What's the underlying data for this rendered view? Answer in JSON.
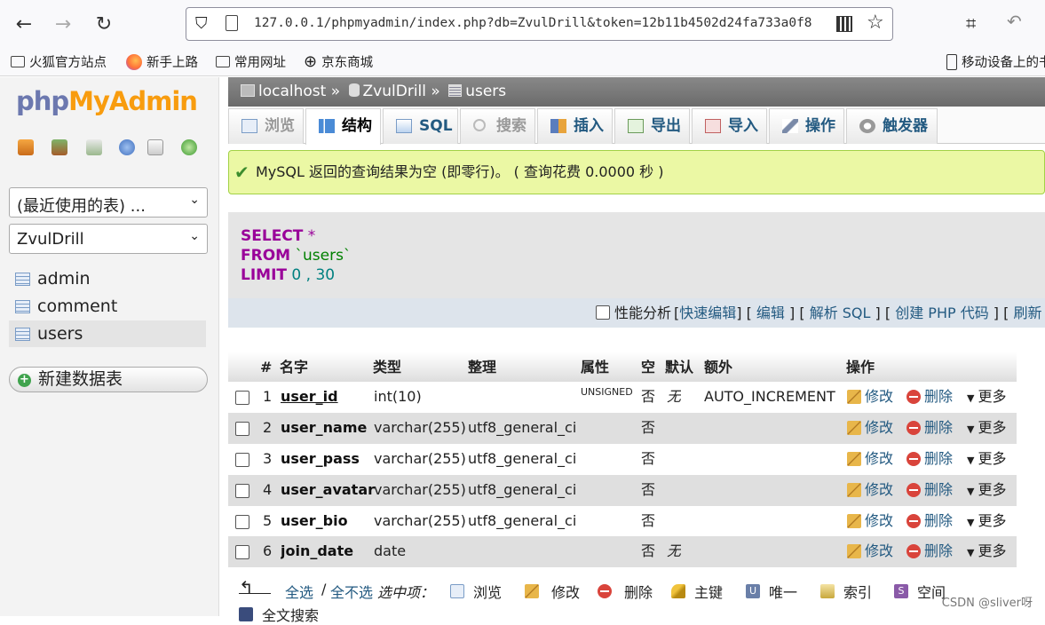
{
  "browser": {
    "url": "127.0.0.1/phpmyadmin/index.php?db=ZvulDrill&token=12b11b4502d24fa733a0f8",
    "bookmarks": [
      "火狐官方站点",
      "新手上路",
      "常用网址",
      "京东商城"
    ],
    "mobile_bookmarks": "移动设备上的书"
  },
  "sidebar": {
    "logo_php": "php",
    "logo_myadmin": "MyAdmin",
    "recent_tables": "(最近使用的表) ...",
    "database": "ZvulDrill",
    "tables": [
      "admin",
      "comment",
      "users"
    ],
    "new_table": "新建数据表"
  },
  "breadcrumb": {
    "server": "localhost",
    "database": "ZvulDrill",
    "table": "users",
    "sep": "»"
  },
  "tabs": [
    "浏览",
    "结构",
    "SQL",
    "搜索",
    "插入",
    "导出",
    "导入",
    "操作",
    "触发器"
  ],
  "notice": "MySQL 返回的查询结果为空 (即零行)。 ( 查询花费 0.0000 秒 )",
  "sql": {
    "select": "SELECT",
    "star": "*",
    "from": "FROM",
    "table": "`users`",
    "limit": "LIMIT",
    "offset": "0",
    "comma": ",",
    "count": "30",
    "profiling": "性能分析",
    "links": [
      "快速编辑",
      "编辑",
      "解析 SQL",
      "创建 PHP 代码",
      "刷新"
    ]
  },
  "structure": {
    "headers": [
      "#",
      "名字",
      "类型",
      "整理",
      "属性",
      "空",
      "默认",
      "额外",
      "操作"
    ],
    "rows": [
      {
        "num": "1",
        "name": "user_id",
        "type": "int(10)",
        "collation": "",
        "attr": "UNSIGNED",
        "null": "否",
        "default": "无",
        "extra": "AUTO_INCREMENT"
      },
      {
        "num": "2",
        "name": "user_name",
        "type": "varchar(255)",
        "collation": "utf8_general_ci",
        "attr": "",
        "null": "否",
        "default": "",
        "extra": ""
      },
      {
        "num": "3",
        "name": "user_pass",
        "type": "varchar(255)",
        "collation": "utf8_general_ci",
        "attr": "",
        "null": "否",
        "default": "",
        "extra": ""
      },
      {
        "num": "4",
        "name": "user_avatar",
        "type": "varchar(255)",
        "collation": "utf8_general_ci",
        "attr": "",
        "null": "否",
        "default": "",
        "extra": ""
      },
      {
        "num": "5",
        "name": "user_bio",
        "type": "varchar(255)",
        "collation": "utf8_general_ci",
        "attr": "",
        "null": "否",
        "default": "",
        "extra": ""
      },
      {
        "num": "6",
        "name": "join_date",
        "type": "date",
        "collation": "",
        "attr": "",
        "null": "否",
        "default": "无",
        "extra": ""
      }
    ],
    "actions": {
      "edit": "修改",
      "delete": "删除",
      "more": "更多"
    }
  },
  "bulk": {
    "select_all": "全选",
    "slash": "/",
    "unselect_all": "全不选",
    "with_selected": "选中项：",
    "browse": "浏览",
    "edit": "修改",
    "delete": "删除",
    "primary": "主键",
    "unique": "唯一",
    "index": "索引",
    "spatial": "空间",
    "fulltext": "全文搜索"
  },
  "watermark": "CSDN @sliver呀"
}
